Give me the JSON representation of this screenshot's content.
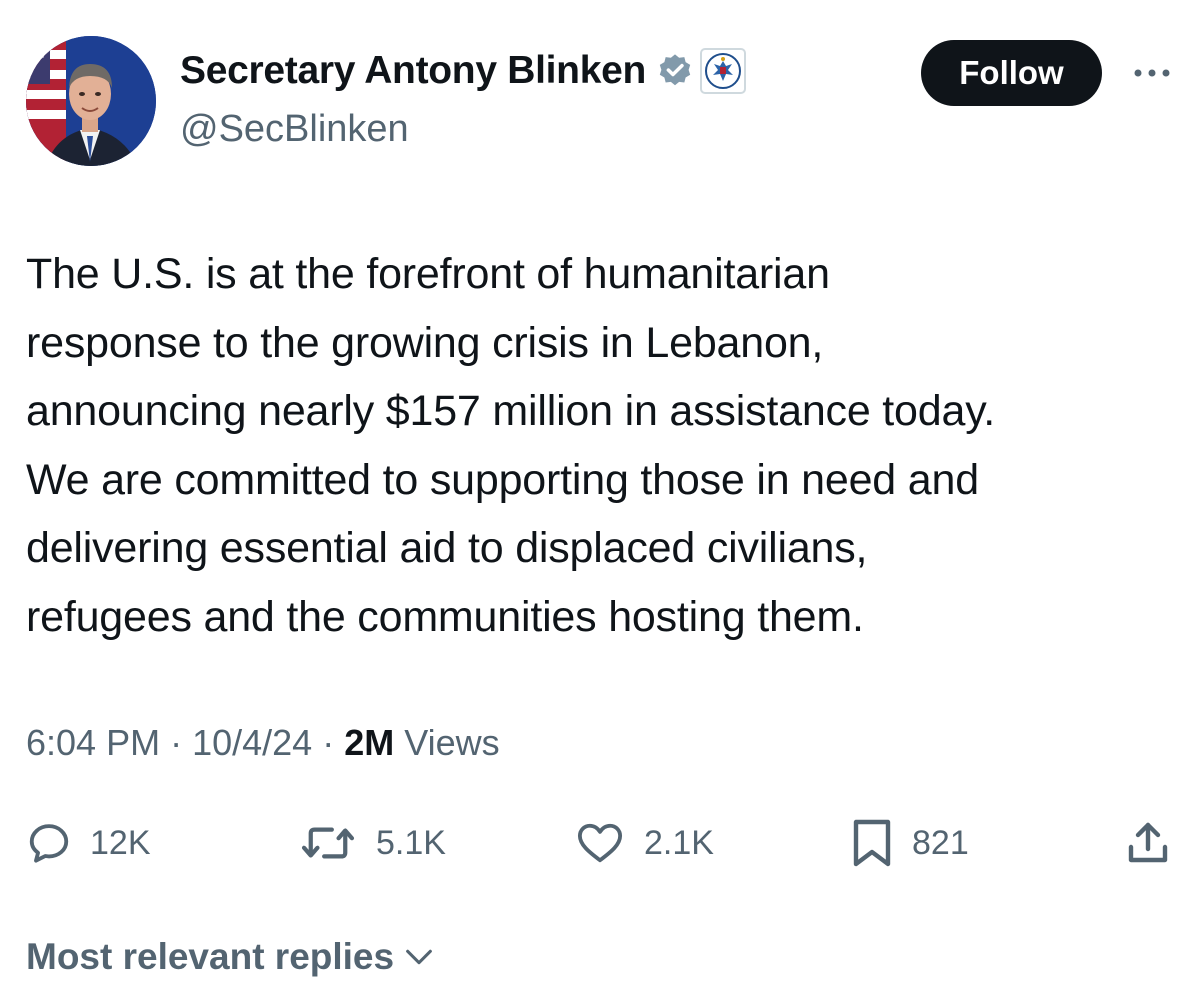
{
  "author": {
    "display_name": "Secretary Antony Blinken",
    "handle": "@SecBlinken",
    "verified_badge_color": "#829aab",
    "affiliation_badge": "seal-icon"
  },
  "follow_button": {
    "label": "Follow",
    "background": "#0f1419"
  },
  "more_menu": {
    "icon": "more-icon"
  },
  "tweet": {
    "lines": [
      "The U.S. is at the forefront of humanitarian",
      "response to the growing crisis in Lebanon,",
      "announcing nearly $157 million in assistance today.",
      "We are committed to supporting those in need and",
      "delivering essential aid to displaced civilians,",
      "refugees and the communities hosting them."
    ]
  },
  "meta": {
    "time": "6:04 PM",
    "separator": "·",
    "date": "10/4/24",
    "views_count": "2M",
    "views_label": "Views"
  },
  "actions": {
    "replies": {
      "count": "12K",
      "icon": "reply-icon"
    },
    "reposts": {
      "count": "5.1K",
      "icon": "repost-icon"
    },
    "likes": {
      "count": "2.1K",
      "icon": "heart-icon"
    },
    "bookmarks": {
      "count": "821",
      "icon": "bookmark-icon"
    },
    "share": {
      "icon": "share-icon"
    }
  },
  "replies_sort": {
    "label": "Most relevant replies",
    "icon": "chevron-down-icon"
  },
  "colors": {
    "text_primary": "#0f1419",
    "text_secondary": "#536471"
  }
}
